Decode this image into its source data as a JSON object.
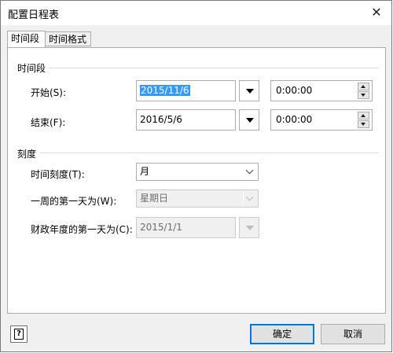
{
  "window": {
    "title": "配置日程表",
    "close_glyph": "✕"
  },
  "tabs": [
    {
      "label": "时间段"
    },
    {
      "label": "时间格式"
    }
  ],
  "time_period": {
    "group_title": "时间段",
    "start_label": "开始(S):",
    "start_date": "2015/11/6",
    "start_time": "0:00:00",
    "end_label": "结束(F):",
    "end_date": "2016/5/6",
    "end_time": "0:00:00"
  },
  "scale": {
    "group_title": "刻度",
    "time_scale_label": "时间刻度(T):",
    "time_scale_value": "月",
    "week_start_label": "一周的第一天为(W):",
    "week_start_value": "星期日",
    "fiscal_start_label": "财政年度的第一天为(C):",
    "fiscal_start_value": "2015/1/1"
  },
  "footer": {
    "help_glyph": "?",
    "ok_label": "确定",
    "cancel_label": "取消"
  },
  "colors": {
    "accent": "#0078d7",
    "selection": "#3399ff"
  }
}
